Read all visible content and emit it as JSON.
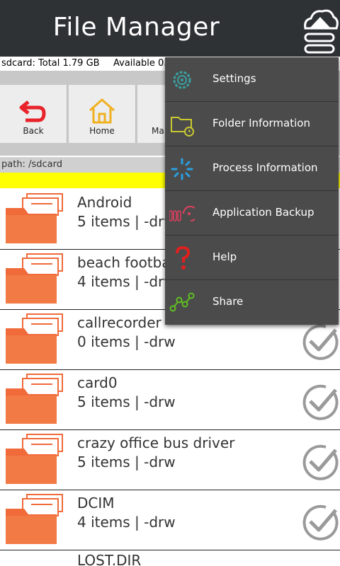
{
  "app": {
    "title": "File Manager"
  },
  "storage": {
    "total": "sdcard: Total 1.79 GB",
    "available": "Available 0."
  },
  "toolbar": [
    {
      "label": "Back"
    },
    {
      "label": "Home"
    },
    {
      "label": "Ma"
    }
  ],
  "path": "path: /sdcard",
  "files": [
    {
      "name": "Android",
      "meta": "5 items | -drw"
    },
    {
      "name": "beach footba",
      "meta": "4 items | -drw"
    },
    {
      "name": "callrecorder",
      "meta": "0 items | -drw"
    },
    {
      "name": "card0",
      "meta": "5 items | -drw"
    },
    {
      "name": "crazy office bus driver",
      "meta": "5 items | -drw"
    },
    {
      "name": "DCIM",
      "meta": "4 items | -drw"
    },
    {
      "name": "LOST.DIR",
      "meta": ""
    }
  ],
  "menu": [
    {
      "label": "Settings",
      "icon": "gear-icon",
      "color": "#3aa0a0"
    },
    {
      "label": "Folder Information",
      "icon": "folder-clock-icon",
      "color": "#c8c832"
    },
    {
      "label": "Process Information",
      "icon": "spinner-icon",
      "color": "#2aa0e0"
    },
    {
      "label": "Application Backup",
      "icon": "backup-icon",
      "color": "#e04060"
    },
    {
      "label": "Help",
      "icon": "question-icon",
      "color": "#e02020"
    },
    {
      "label": "Share",
      "icon": "share-icon",
      "color": "#60c020"
    }
  ],
  "colors": {
    "titlebar": "#2f3235",
    "folder": "#f06a3a",
    "accent": "#ffff00",
    "menu": "#4b4b4b"
  }
}
